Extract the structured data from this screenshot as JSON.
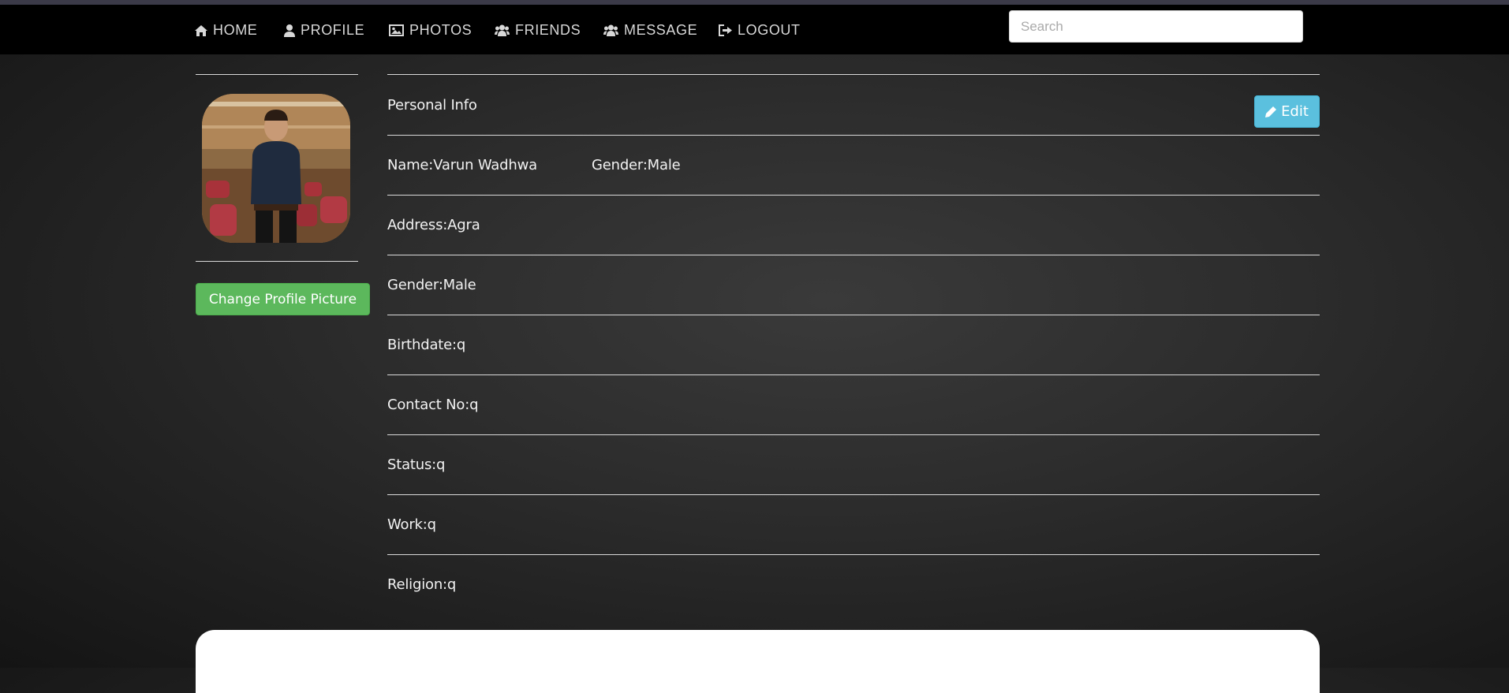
{
  "nav": {
    "items": [
      {
        "label": "HOME",
        "icon": "home-icon"
      },
      {
        "label": "PROFILE",
        "icon": "user-icon"
      },
      {
        "label": "PHOTOS",
        "icon": "picture-icon"
      },
      {
        "label": "FRIENDS",
        "icon": "users-icon"
      },
      {
        "label": "MESSAGE",
        "icon": "users-icon"
      },
      {
        "label": "LOGOUT",
        "icon": "logout-icon"
      }
    ],
    "search_placeholder": "Search",
    "search_value": ""
  },
  "sidebar": {
    "change_picture_label": "Change Profile Picture",
    "avatar_alt": "profile-photo"
  },
  "info": {
    "title": "Personal Info",
    "edit_label": "Edit",
    "name": "Name:Varun Wadhwa",
    "gender_inline": "Gender:Male",
    "address": "Address:Agra",
    "gender": "Gender:Male",
    "birthdate": "Birthdate:q",
    "contact": "Contact No:q",
    "status": "Status:q",
    "work": "Work:q",
    "religion": "Religion:q"
  },
  "colors": {
    "navbar": "#000000",
    "success_button": "#5cb85c",
    "info_button": "#5bc0de"
  }
}
